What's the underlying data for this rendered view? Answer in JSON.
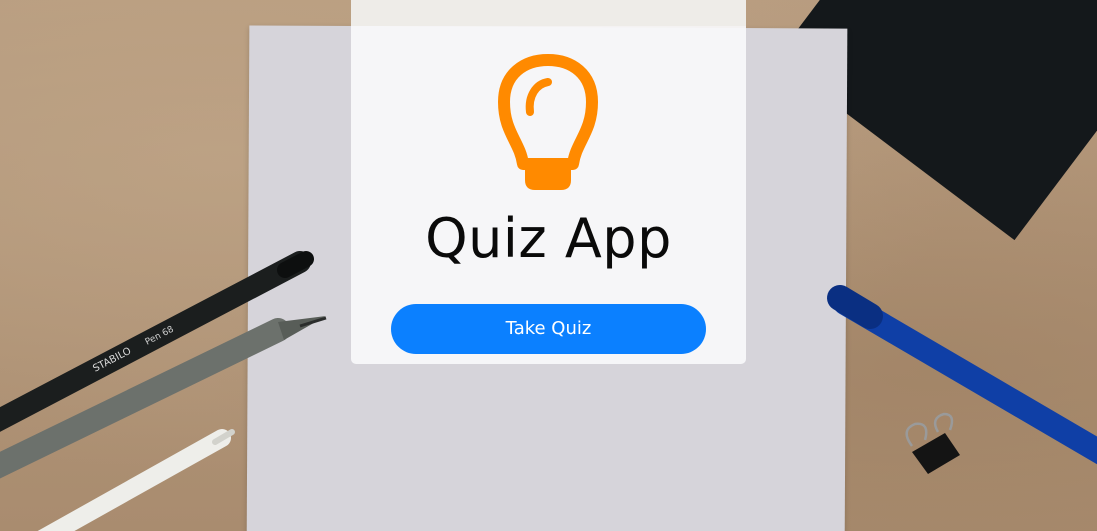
{
  "app": {
    "title": "Quiz App",
    "logo_icon": "lightbulb-icon",
    "accent_color": "#ff8a00"
  },
  "actions": {
    "take_quiz_label": "Take Quiz",
    "button_color": "#0b80ff"
  },
  "background": {
    "pen_label_1": "STABILO",
    "pen_label_2": "Pen 68"
  }
}
